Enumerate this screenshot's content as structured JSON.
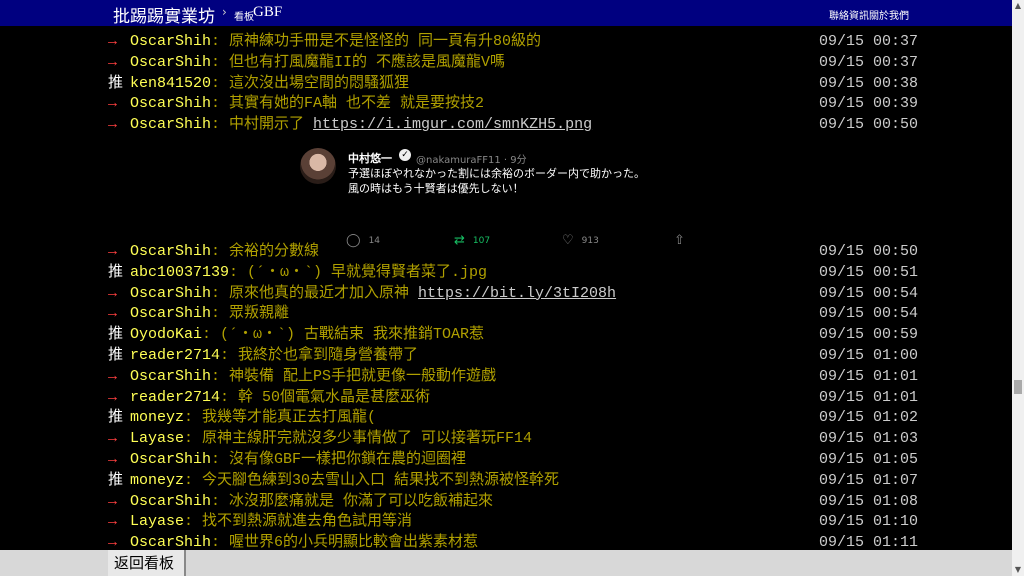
{
  "header": {
    "board_title": "批踢踢實業坊",
    "separator": "›",
    "crumb_label": "看板",
    "board_name": "GBF",
    "links": [
      "聯絡資訊",
      "關於我們"
    ]
  },
  "comments_top": [
    {
      "tag": "→",
      "user": "OscarShih",
      "text": ": 原神練功手冊是不是怪怪的 同一頁有升80級的",
      "time": "09/15 00:37"
    },
    {
      "tag": "→",
      "user": "OscarShih",
      "text": ": 但也有打風魔龍II的 不應該是風魔龍V嗎",
      "time": "09/15 00:37"
    },
    {
      "tag": "推",
      "user": "ken841520",
      "text": ": 這次沒出場空間的悶騷狐狸",
      "time": "09/15 00:38"
    },
    {
      "tag": "→",
      "user": "OscarShih",
      "text": ": 其實有她的FA軸 也不差 就是要按技2",
      "time": "09/15 00:39"
    },
    {
      "tag": "→",
      "user": "OscarShih",
      "text": ": 中村開示了 ",
      "url": "https://i.imgur.com/smnKZH5.png",
      "time": "09/15 00:50"
    }
  ],
  "tweet": {
    "name": "中村悠一",
    "verified_mark": "✓",
    "handle": "@nakamuraFF11 · 9分",
    "line1": "予選ほぼやれなかった割には余裕のボーダー内で助かった。",
    "line2": "風の時はもう十賢者は優先しない！",
    "replies": "14",
    "retweets": "107",
    "likes": "913"
  },
  "comments_bottom": [
    {
      "tag": "→",
      "user": "OscarShih",
      "text": ": 余裕的分數線",
      "time": "09/15 00:50"
    },
    {
      "tag": "推",
      "user": "abc10037139",
      "text": ": (´・ω・`) 早就覺得賢者菜了.jpg",
      "time": "09/15 00:51"
    },
    {
      "tag": "→",
      "user": "OscarShih",
      "text": ": 原來他真的最近才加入原神 ",
      "url": "https://bit.ly/3tI208h",
      "time": "09/15 00:54"
    },
    {
      "tag": "→",
      "user": "OscarShih",
      "text": ": 眾叛親離",
      "time": "09/15 00:54"
    },
    {
      "tag": "推",
      "user": "OyodoKai",
      "text": ": (´・ω・`) 古戰結束 我來推銷TOAR惹",
      "time": "09/15 00:59"
    },
    {
      "tag": "推",
      "user": "reader2714",
      "text": ": 我終於也拿到隨身營養帶了",
      "time": "09/15 01:00"
    },
    {
      "tag": "→",
      "user": "OscarShih",
      "text": ": 神裝備 配上PS手把就更像一般動作遊戲",
      "time": "09/15 01:01"
    },
    {
      "tag": "→",
      "user": "reader2714",
      "text": ": 幹 50個電氣水晶是甚麼巫術",
      "time": "09/15 01:01"
    },
    {
      "tag": "推",
      "user": "moneyz",
      "text": ": 我幾等才能真正去打風龍(",
      "time": "09/15 01:02"
    },
    {
      "tag": "→",
      "user": "Layase",
      "text": ": 原神主線肝完就沒多少事情做了 可以接著玩FF14",
      "time": "09/15 01:03"
    },
    {
      "tag": "→",
      "user": "OscarShih",
      "text": ": 沒有像GBF一樣把你鎖在農的迴圈裡",
      "time": "09/15 01:05"
    },
    {
      "tag": "推",
      "user": "moneyz",
      "text": ": 今天腳色練到30去雪山入口 結果找不到熱源被怪幹死",
      "time": "09/15 01:07"
    },
    {
      "tag": "→",
      "user": "OscarShih",
      "text": ": 冰沒那麼痛就是 你滿了可以吃飯補起來",
      "time": "09/15 01:08"
    },
    {
      "tag": "→",
      "user": "Layase",
      "text": ": 找不到熱源就進去角色試用等消",
      "time": "09/15 01:10"
    },
    {
      "tag": "→",
      "user": "OscarShih",
      "text": ": 喔世界6的小兵明顯比較會出紫素材惹",
      "time": "09/15 01:11"
    }
  ],
  "footer": {
    "back_label": "返回看板"
  }
}
